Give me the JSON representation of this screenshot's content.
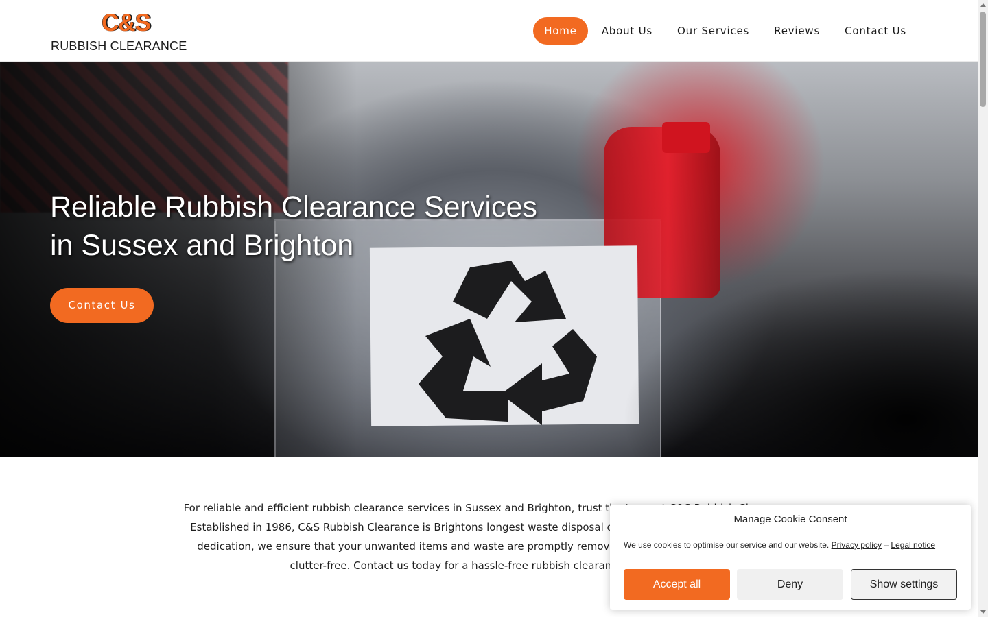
{
  "header": {
    "logo": {
      "mark": "C&S",
      "subtitle": "RUBBISH CLEARANCE"
    },
    "nav": [
      {
        "label": "Home",
        "active": true
      },
      {
        "label": "About Us",
        "active": false
      },
      {
        "label": "Our Services",
        "active": false
      },
      {
        "label": "Reviews",
        "active": false
      },
      {
        "label": "Contact Us",
        "active": false
      }
    ]
  },
  "hero": {
    "title_line1": "Reliable Rubbish Clearance Services",
    "title_line2": "in Sussex and Brighton",
    "cta_label": "Contact Us",
    "image_icon": "recycle-icon"
  },
  "intro": {
    "text": "For reliable and efficient rubbish clearance services in Sussex and Brighton, trust the team at C&S Rubbish Clearance. Established in 1986, C&S Rubbish Clearance is Brightons longest waste disposal companies. With our expertise and dedication, we ensure that your unwanted items and waste are promptly removed, leaving your space clean and clutter-free. Contact us today for a hassle-free rubbish clearance experience."
  },
  "cookie": {
    "title": "Manage Cookie Consent",
    "text": "We use cookies to optimise our service and our website.",
    "privacy_link": "Privacy policy",
    "separator": "–",
    "legal_link": "Legal notice",
    "accept_label": "Accept all",
    "deny_label": "Deny",
    "settings_label": "Show settings"
  },
  "colors": {
    "accent": "#f26a21",
    "text": "#1f1f1f",
    "background": "#ffffff"
  }
}
